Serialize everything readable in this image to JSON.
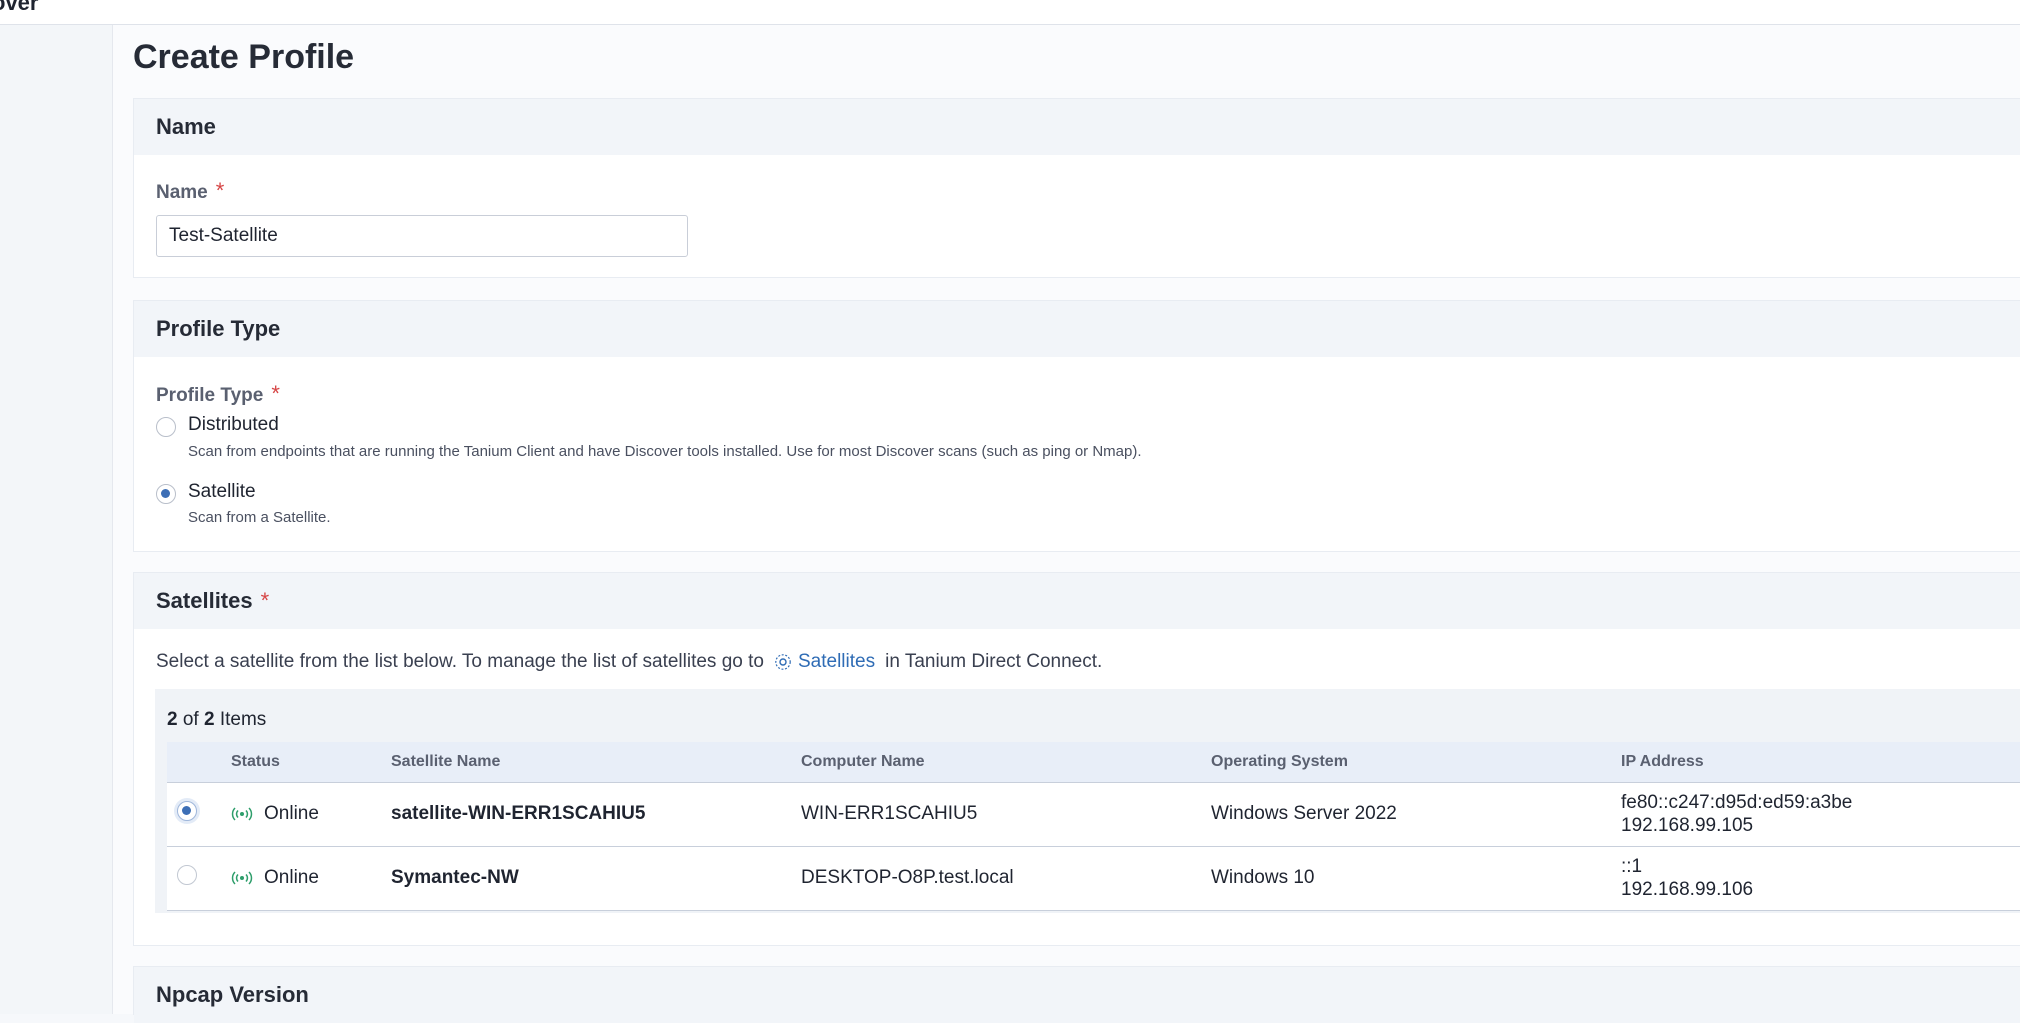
{
  "topbar": {
    "fragment": "over"
  },
  "page": {
    "title": "Create Profile"
  },
  "name_section": {
    "heading": "Name",
    "field_label": "Name",
    "required_marker": "*",
    "value": "Test-Satellite"
  },
  "profile_type_section": {
    "heading": "Profile Type",
    "field_label": "Profile Type",
    "required_marker": "*",
    "options": [
      {
        "label": "Distributed",
        "help": "Scan from endpoints that are running the Tanium Client and have Discover tools installed. Use for most Discover scans (such as ping or Nmap).",
        "selected": false
      },
      {
        "label": "Satellite",
        "help": "Scan from a Satellite.",
        "selected": true
      }
    ]
  },
  "satellites_section": {
    "heading": "Satellites",
    "required_marker": "*",
    "info_prefix": "Select a satellite from the list below. To manage the list of satellites go to",
    "info_link": "Satellites",
    "info_suffix": "in Tanium Direct Connect.",
    "count_shown": "2",
    "count_of": "of",
    "count_total": "2",
    "count_label": "Items",
    "columns": [
      "Status",
      "Satellite Name",
      "Computer Name",
      "Operating System",
      "IP Address"
    ],
    "rows": [
      {
        "selected": true,
        "status": "Online",
        "satellite_name": "satellite-WIN-ERR1SCAHIU5",
        "computer_name": "WIN-ERR1SCAHIU5",
        "os": "Windows Server 2022",
        "ip1": "fe80::c247:d95d:ed59:a3be",
        "ip2": "192.168.99.105"
      },
      {
        "selected": false,
        "status": "Online",
        "satellite_name": "Symantec-NW",
        "computer_name": "DESKTOP-O8P.test.local",
        "os": "Windows 10",
        "ip1": "::1",
        "ip2": "192.168.99.106"
      }
    ]
  },
  "npcap_section": {
    "heading": "Npcap Version"
  },
  "colors": {
    "accent": "#2f6cb5",
    "required": "#d64545",
    "online": "#2e9e6b"
  },
  "icons": {
    "satellite_link": "satellite-icon",
    "status": "signal-online-icon"
  }
}
